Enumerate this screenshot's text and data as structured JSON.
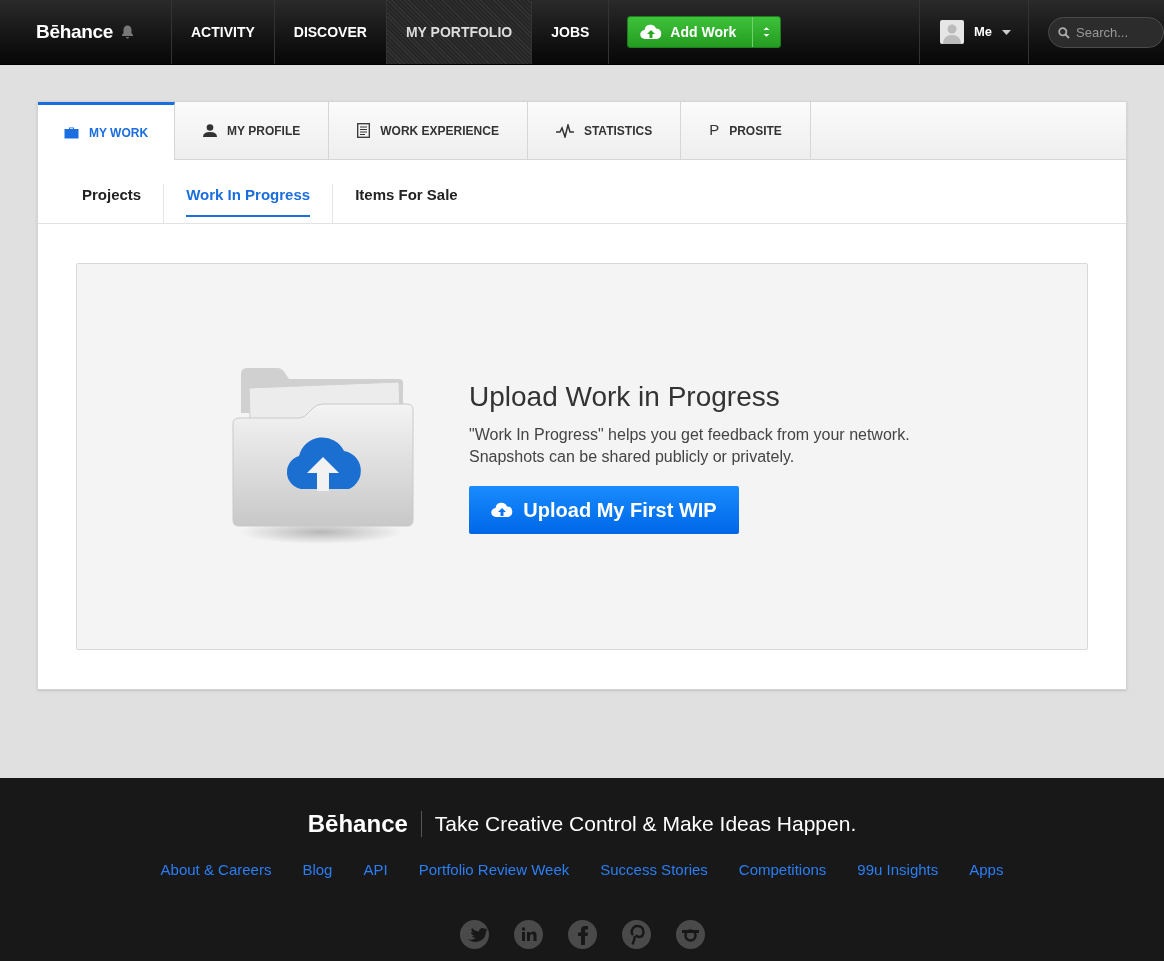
{
  "nav": {
    "logo": "Bēhance",
    "items": [
      {
        "label": "ACTIVITY",
        "selected": false
      },
      {
        "label": "DISCOVER",
        "selected": false
      },
      {
        "label": "MY PORTFOLIO",
        "selected": true
      },
      {
        "label": "JOBS",
        "selected": false
      }
    ],
    "add_button": "Add Work",
    "user": "Me",
    "search": {
      "placeholder": "Search..."
    }
  },
  "tabs": [
    {
      "label": "MY WORK",
      "kind": "work",
      "selected": true
    },
    {
      "label": "MY PROFILE",
      "kind": "profile",
      "selected": false
    },
    {
      "label": "WORK EXPERIENCE",
      "kind": "experience",
      "selected": false
    },
    {
      "label": "STATISTICS",
      "kind": "stats",
      "selected": false
    },
    {
      "label": "PROSITE",
      "kind": "site",
      "icon_text": "P",
      "selected": false
    }
  ],
  "subtabs": [
    {
      "label": "Projects",
      "selected": false
    },
    {
      "label": "Work In Progress",
      "selected": true
    },
    {
      "label": "Items For Sale",
      "selected": false
    }
  ],
  "empty_state": {
    "title": "Upload Work in Progress",
    "description": [
      "\"Work In Progress\" helps you get feedback from your network.",
      "Snapshots can be shared publicly or privately."
    ],
    "button": "Upload My First WIP"
  },
  "footer": {
    "logo": "Bēhance",
    "tagline": "Take Creative Control & Make Ideas Happen.",
    "links": [
      "About & Careers",
      "Blog",
      "API",
      "Portfolio Review Week",
      "Success Stories",
      "Competitions",
      "99u Insights",
      "Apps"
    ]
  }
}
